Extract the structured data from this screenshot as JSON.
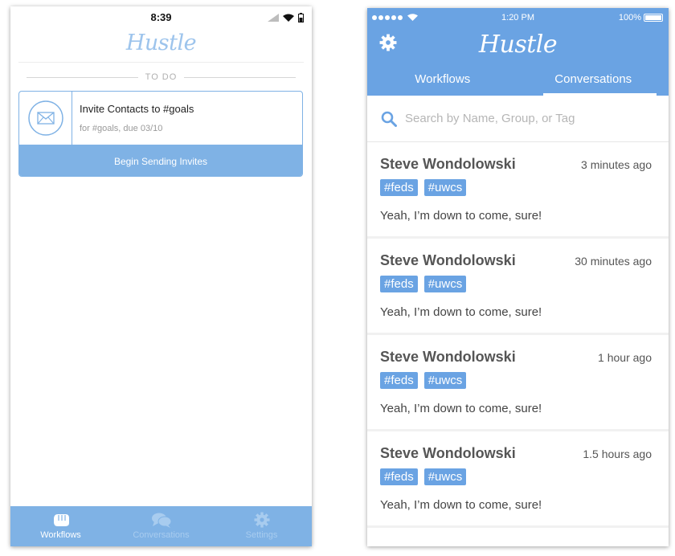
{
  "left": {
    "status": {
      "time": "8:39"
    },
    "logo": "Hustle",
    "section_label": "TO DO",
    "task": {
      "title": "Invite Contacts to #goals",
      "subtitle": "for #goals, due 03/10",
      "button_label": "Begin Sending Invites",
      "icon": "envelope-icon"
    },
    "tabbar": [
      {
        "label": "Workflows",
        "icon": "fist-icon",
        "active": true
      },
      {
        "label": "Conversations",
        "icon": "chat-bubbles-icon",
        "active": false
      },
      {
        "label": "Settings",
        "icon": "gear-icon",
        "active": false
      }
    ]
  },
  "right": {
    "status": {
      "time": "1:20 PM",
      "battery": "100%"
    },
    "logo": "Hustle",
    "tabs": [
      {
        "label": "Workflows",
        "active": false
      },
      {
        "label": "Conversations",
        "active": true
      }
    ],
    "search": {
      "placeholder": "Search by Name, Group, or Tag"
    },
    "conversations": [
      {
        "name": "Steve Wondolowski",
        "time": "3 minutes ago",
        "tags": [
          "#feds",
          "#uwcs"
        ],
        "message": "Yeah, I’m down to come, sure!"
      },
      {
        "name": "Steve Wondolowski",
        "time": "30 minutes ago",
        "tags": [
          "#feds",
          "#uwcs"
        ],
        "message": "Yeah, I’m down to come, sure!"
      },
      {
        "name": "Steve Wondolowski",
        "time": "1 hour ago",
        "tags": [
          "#feds",
          "#uwcs"
        ],
        "message": "Yeah, I’m down to come, sure!"
      },
      {
        "name": "Steve Wondolowski",
        "time": "1.5 hours ago",
        "tags": [
          "#feds",
          "#uwcs"
        ],
        "message": "Yeah, I’m down to come, sure!"
      }
    ]
  },
  "colors": {
    "brand_blue": "#6aa3e3",
    "light_blue": "#7fb2e5",
    "logo_light": "#9dc4ec"
  }
}
